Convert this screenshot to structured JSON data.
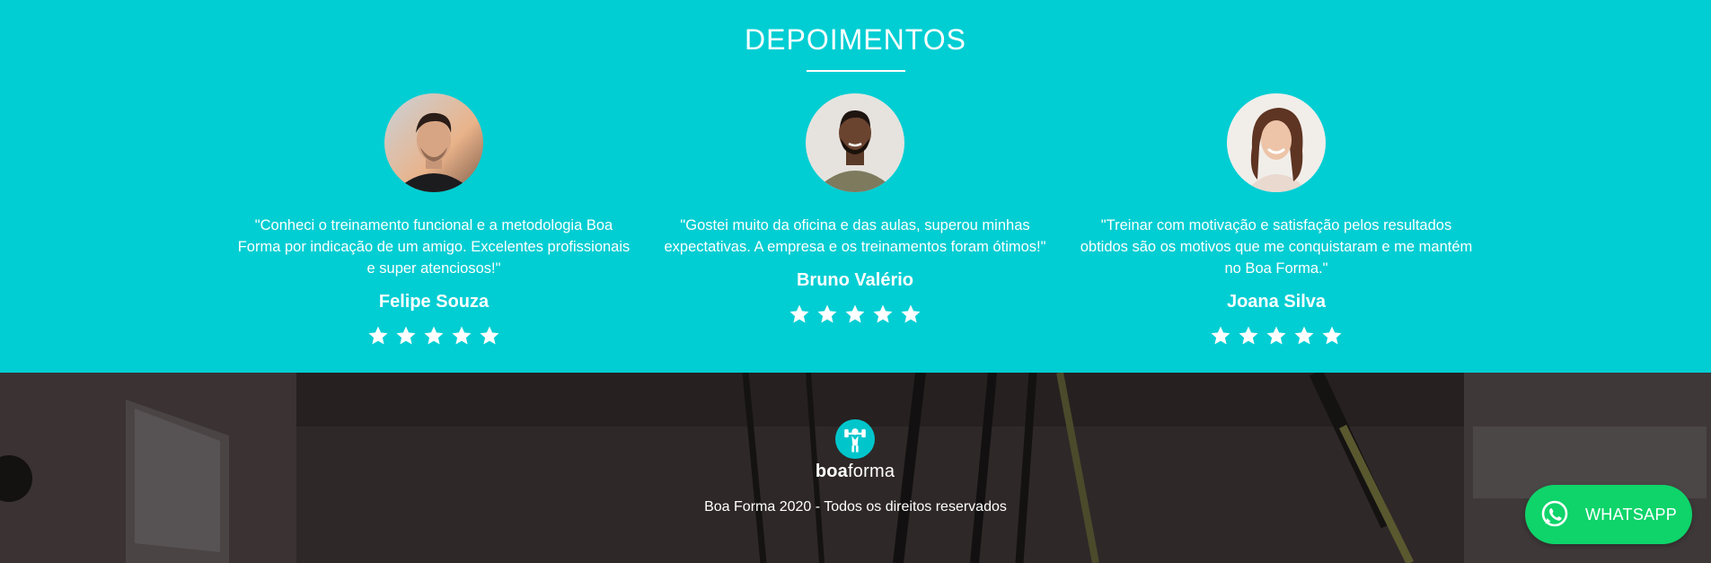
{
  "testimonials": {
    "title": "DEPOIMENTOS",
    "items": [
      {
        "quote": "\"Conheci o treinamento funcional e a metodologia Boa Forma por indicação de um amigo. Excelentes profissionais e super atenciosos!\"",
        "name": "Felipe Souza",
        "rating": 5
      },
      {
        "quote": "\"Gostei muito da oficina e das aulas, superou minhas expectativas. A empresa e os treinamentos foram ótimos!\"",
        "name": "Bruno Valério",
        "rating": 5
      },
      {
        "quote": "\"Treinar com motivação e satisfação pelos resultados obtidos são os motivos que me conquistaram e me mantém no Boa Forma.\"",
        "name": "Joana Silva",
        "rating": 5
      }
    ]
  },
  "footer": {
    "logo_bold": "boa",
    "logo_regular": "forma",
    "copyright": "Boa Forma 2020 - Todos os direitos reservados"
  },
  "whatsapp": {
    "label": "WHATSAPP"
  },
  "colors": {
    "accent": "#00ced3",
    "whatsapp": "#0ed46a",
    "footer_bg": "#2b2525"
  }
}
